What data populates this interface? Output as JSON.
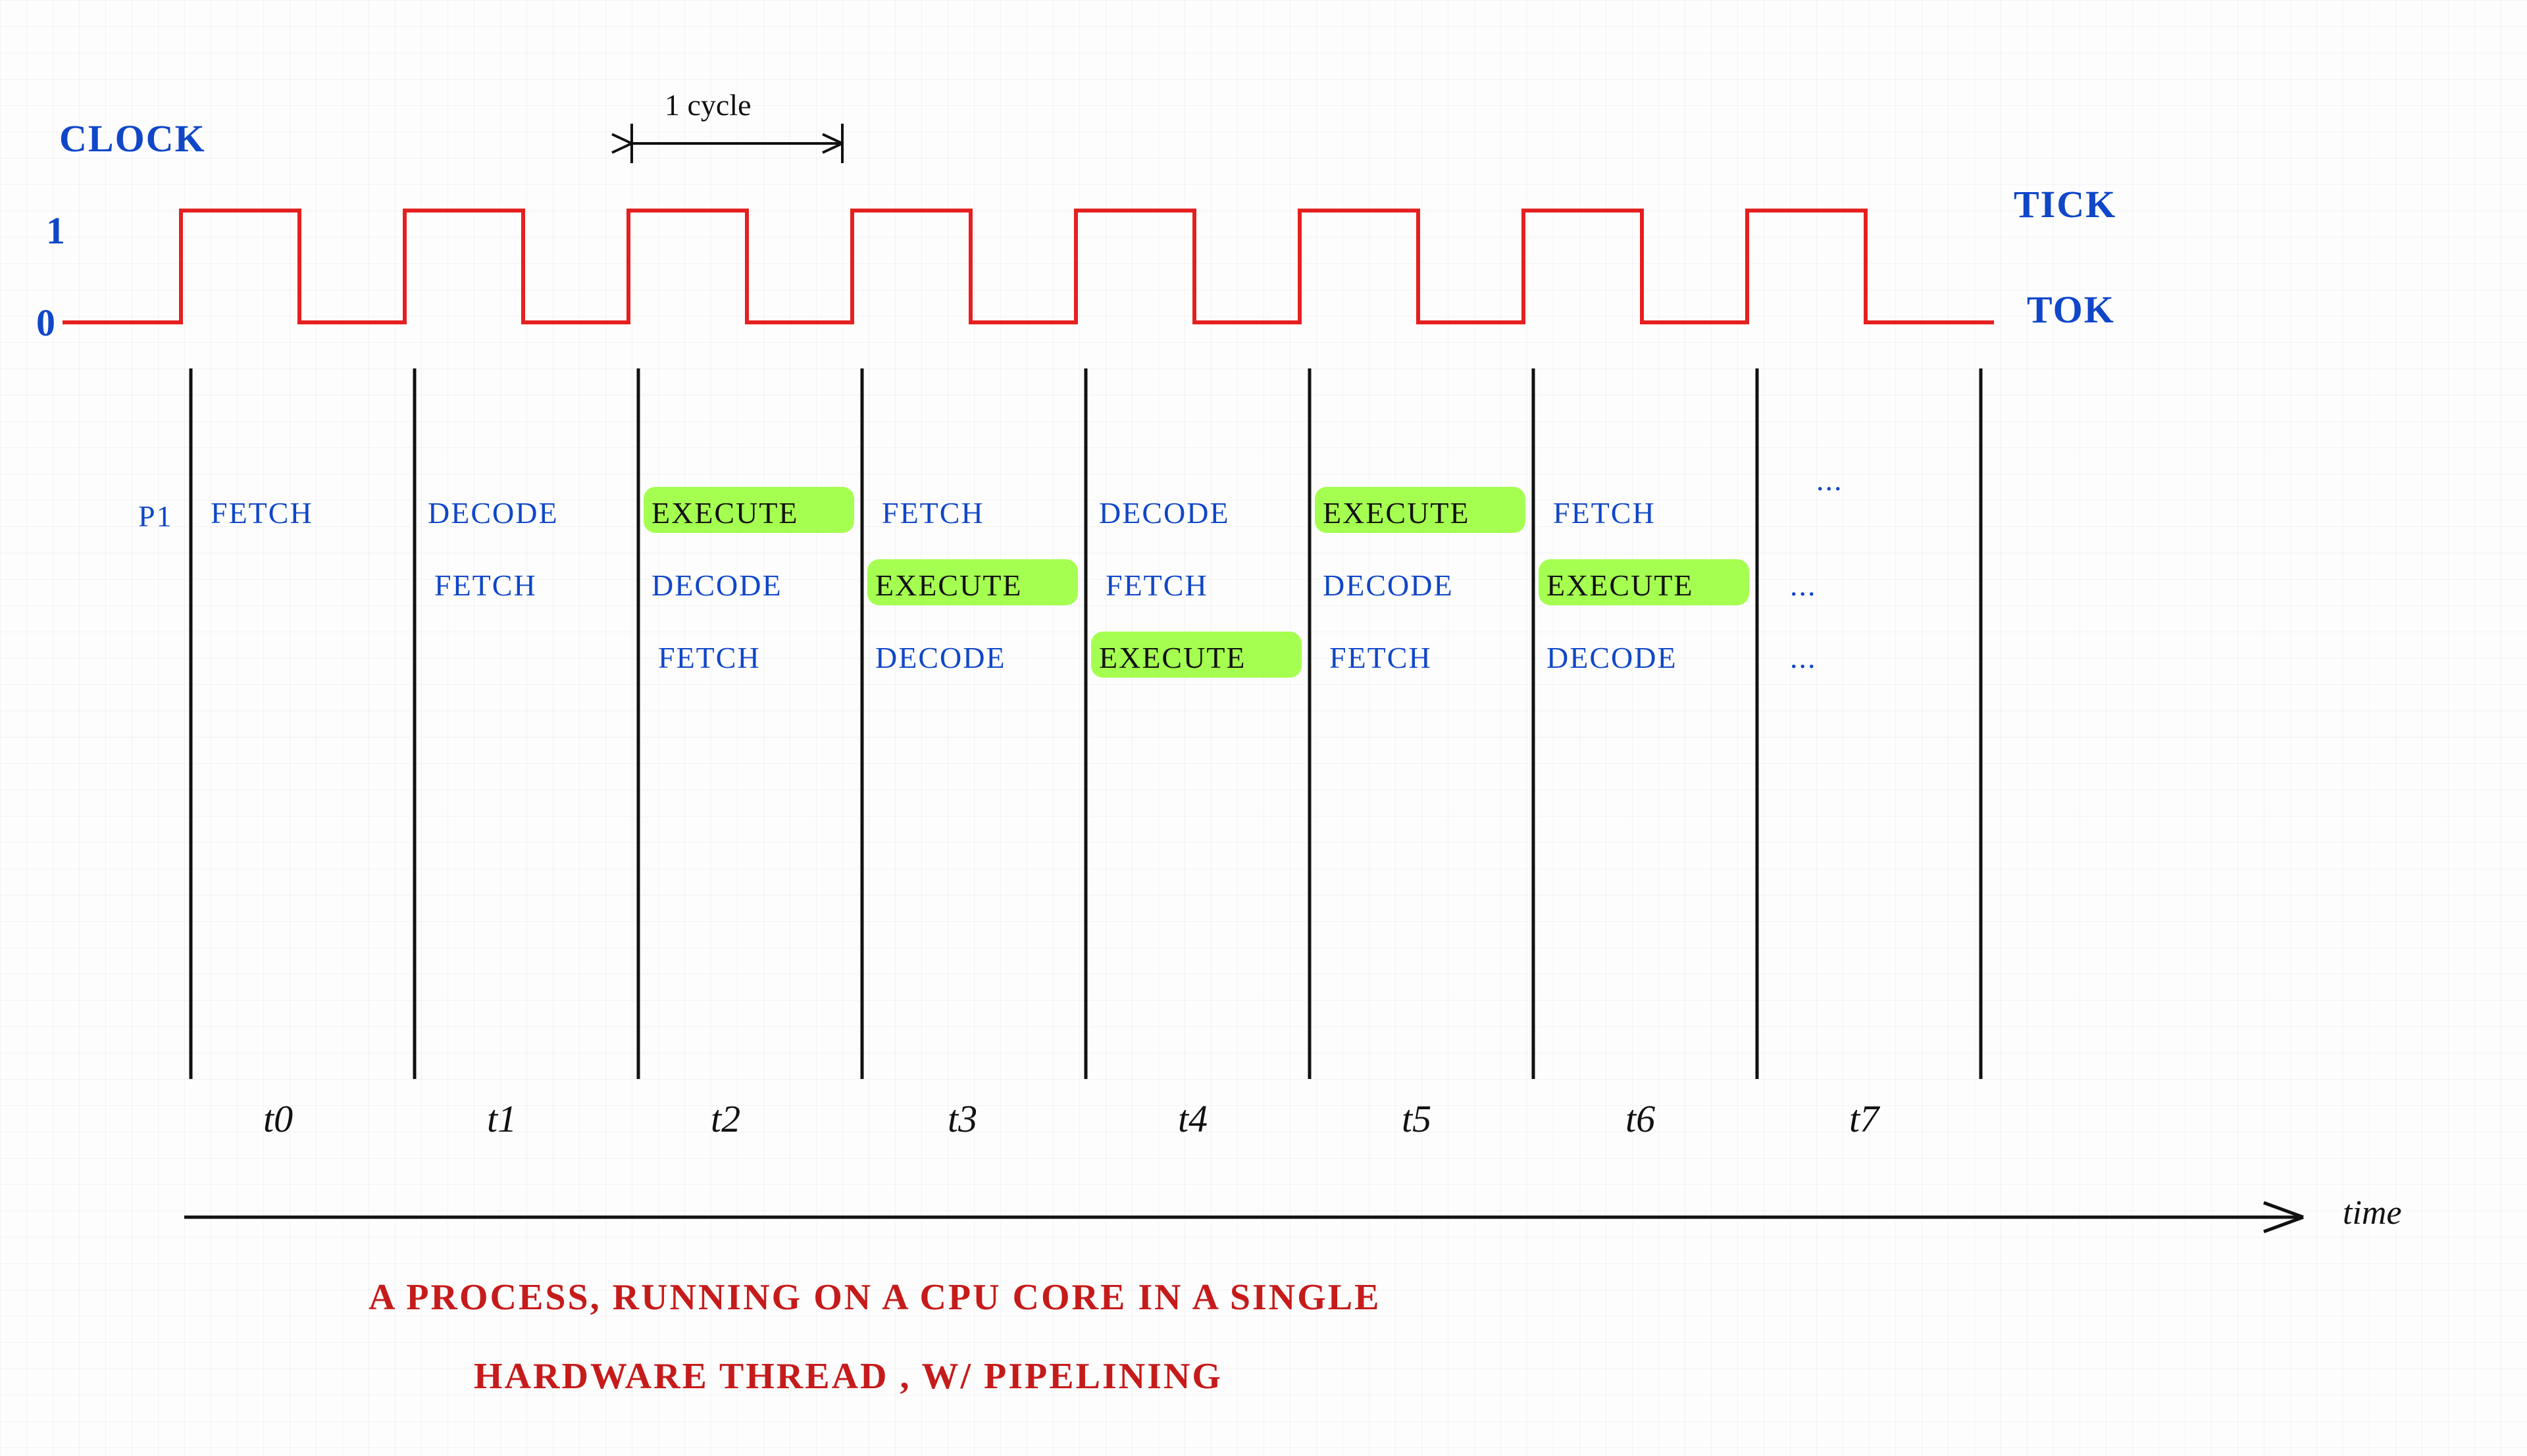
{
  "chart_data": {
    "type": "table",
    "title": "A PROCESS, RUNNING ON A CPU CORE IN A SINGLE HARDWARE THREAD, W/ PIPELINING",
    "xlabel": "time",
    "cycle_label": "1 cycle",
    "clock_label": "CLOCK",
    "clock_hi": "1",
    "clock_lo": "0",
    "tick_label": "TICK",
    "tok_label": "TOK",
    "pipe_label": "P1",
    "ticks": [
      "t0",
      "t1",
      "t2",
      "t3",
      "t4",
      "t5",
      "t6",
      "t7"
    ],
    "columns": [
      "t0",
      "t1",
      "t2",
      "t3",
      "t4",
      "t5",
      "t6",
      "t7"
    ],
    "rows": [
      {
        "start": 0,
        "cells": [
          "FETCH",
          "DECODE",
          "EXECUTE",
          "FETCH",
          "DECODE",
          "EXECUTE",
          "FETCH",
          "..."
        ]
      },
      {
        "start": 1,
        "cells": [
          "FETCH",
          "DECODE",
          "EXECUTE",
          "FETCH",
          "DECODE",
          "EXECUTE",
          "..."
        ]
      },
      {
        "start": 2,
        "cells": [
          "FETCH",
          "DECODE",
          "EXECUTE",
          "FETCH",
          "DECODE",
          "..."
        ]
      }
    ],
    "highlight_stage": "EXECUTE",
    "clock_cycles": 8
  },
  "caption_line1": "A PROCESS, RUNNING ON A CPU CORE IN A SINGLE",
  "caption_line2": "HARDWARE THREAD , W/ PIPELINING",
  "ellipsis": ". . ."
}
